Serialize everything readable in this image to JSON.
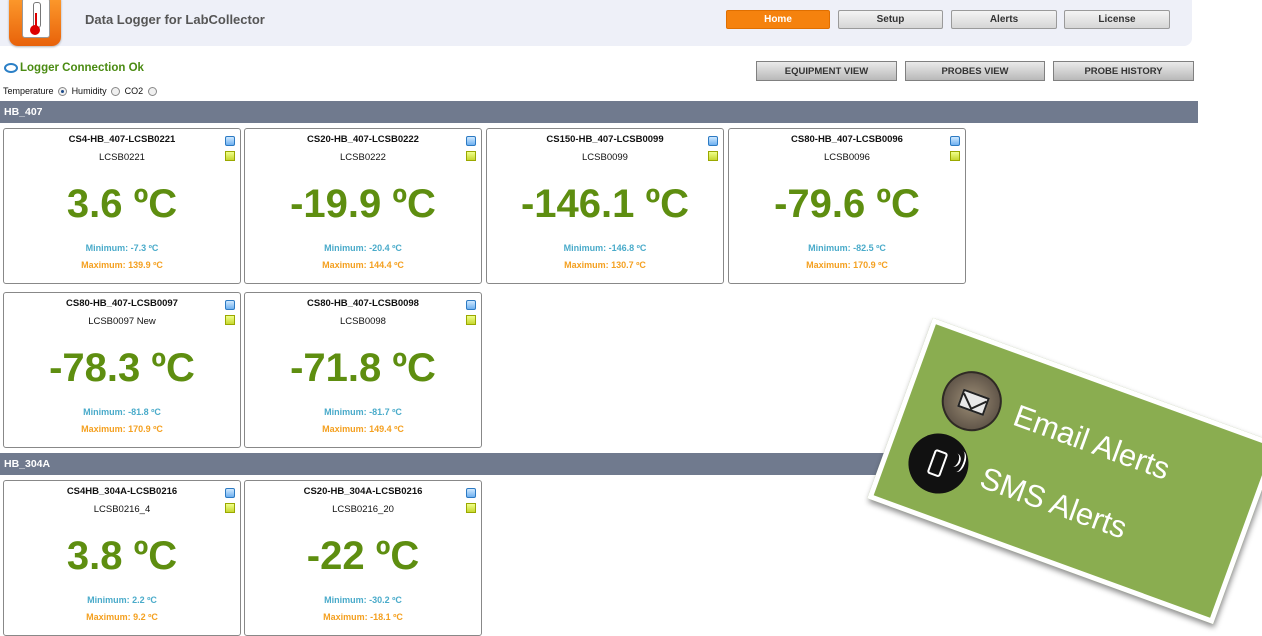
{
  "header": {
    "title": "Data Logger for LabCollector",
    "nav": [
      "Home",
      "Setup",
      "Alerts",
      "License"
    ],
    "active_nav": "Home"
  },
  "status": {
    "connection": "Logger Connection Ok"
  },
  "views": [
    "EQUIPMENT VIEW",
    "PROBES VIEW",
    "PROBE HISTORY"
  ],
  "units": {
    "options": [
      "Temperature",
      "Humidity",
      "CO2"
    ],
    "selected": "Temperature"
  },
  "groups": [
    {
      "name": "HB_407",
      "probes": [
        {
          "name": "CS4-HB_407-LCSB0221",
          "serial": "LCSB0221",
          "value": "3.6 ºC",
          "min": "Minimum: -7.3 ºC",
          "max": "Maximum: 139.9 ºC"
        },
        {
          "name": "CS20-HB_407-LCSB0222",
          "serial": "LCSB0222",
          "value": "-19.9 ºC",
          "min": "Minimum: -20.4 ºC",
          "max": "Maximum: 144.4 ºC"
        },
        {
          "name": "CS150-HB_407-LCSB0099",
          "serial": "LCSB0099",
          "value": "-146.1 ºC",
          "min": "Minimum: -146.8 ºC",
          "max": "Maximum: 130.7 ºC"
        },
        {
          "name": "CS80-HB_407-LCSB0096",
          "serial": "LCSB0096",
          "value": "-79.6 ºC",
          "min": "Minimum: -82.5 ºC",
          "max": "Maximum: 170.9 ºC"
        },
        {
          "name": "CS80-HB_407-LCSB0097",
          "serial": "LCSB0097 New",
          "value": "-78.3 ºC",
          "min": "Minimum: -81.8 ºC",
          "max": "Maximum: 170.9 ºC"
        },
        {
          "name": "CS80-HB_407-LCSB0098",
          "serial": "LCSB0098",
          "value": "-71.8 ºC",
          "min": "Minimum: -81.7 ºC",
          "max": "Maximum: 149.4 ºC"
        }
      ]
    },
    {
      "name": "HB_304A",
      "probes": [
        {
          "name": "CS4HB_304A-LCSB0216",
          "serial": "LCSB0216_4",
          "value": "3.8 ºC",
          "min": "Minimum: 2.2 ºC",
          "max": "Maximum: 9.2 ºC"
        },
        {
          "name": "CS20-HB_304A-LCSB0216",
          "serial": "LCSB0216_20",
          "value": "-22 ºC",
          "min": "Minimum: -30.2 ºC",
          "max": "Maximum: -18.1 ºC"
        }
      ]
    }
  ],
  "promo": {
    "email": "Email Alerts",
    "sms": "SMS Alerts"
  },
  "colors": {
    "accent": "#f5820e",
    "value_green": "#5e8e10",
    "min_blue": "#4aabca",
    "max_orange": "#f4a020",
    "group_bar": "#707a8e",
    "promo_green": "#8aad50"
  }
}
